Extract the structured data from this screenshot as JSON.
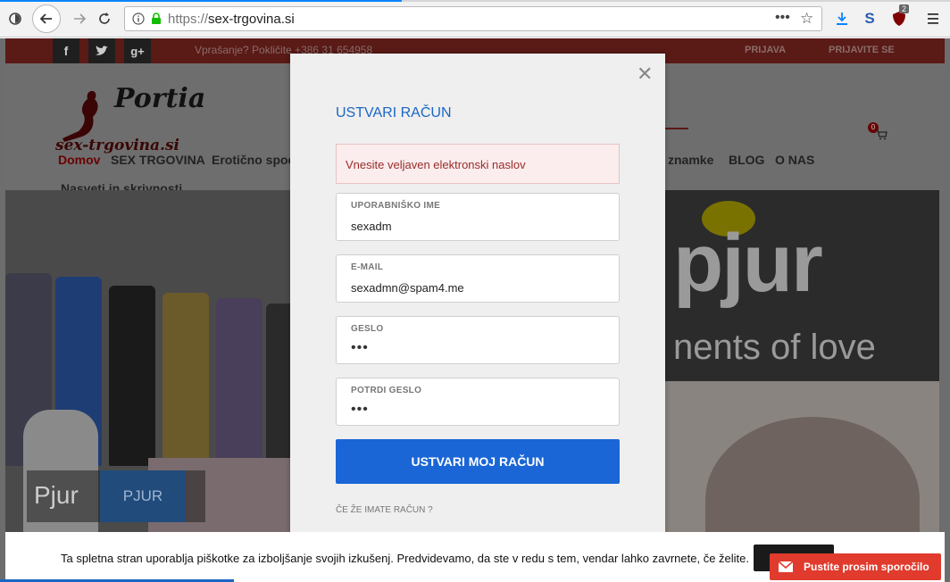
{
  "browser": {
    "url_proto": "https://",
    "url_domain": "sex-trgovina.si",
    "badge_count": "2",
    "s_icon": "S"
  },
  "topbar": {
    "phone": "Vprašanje? Pokličite  +386 31 654958",
    "login": "PRIJAVA",
    "signup": "PRIJAVITE SE"
  },
  "header": {
    "logo_title": "Portia",
    "logo_sub": "sex-trgovina.si",
    "nav": [
      "Domov",
      "SEX TRGOVINA",
      "Erotično spod",
      "znamke",
      "BLOG",
      "O NAS",
      "Nasveti in skrivnosti"
    ],
    "cart_count": "0"
  },
  "banner": {
    "brand": "pjur",
    "slogan": "nents of love",
    "caption_big": "Pjur",
    "caption_tag": "PJUR"
  },
  "modal": {
    "title": "USTVARI RAČUN",
    "error": "Vnesite veljaven elektronski naslov",
    "fields": {
      "username": {
        "label": "UPORABNIŠKO IME",
        "value": "sexadm"
      },
      "email": {
        "label": "E-MAIL",
        "value": "sexadmn@spam4.me"
      },
      "password": {
        "label": "GESLO",
        "value": "•••"
      },
      "confirm": {
        "label": "POTRDI GESLO",
        "value": "•••"
      }
    },
    "submit": "USTVARI MOJ RAČUN",
    "have_account": "ČE ŽE IMATE RAČUN ?"
  },
  "cookie": {
    "text": "Ta spletna stran uporablja piškotke za izboljšanje svojih izkušenj. Predvidevamo, da ste v redu s tem, vendar lahko zavrnete, če želite."
  },
  "notify": {
    "label": "Pustite prosim sporočilo"
  },
  "colors": {
    "accent": "#1a66d6",
    "topbar": "#5a1a16",
    "notify": "#e03b2d"
  }
}
